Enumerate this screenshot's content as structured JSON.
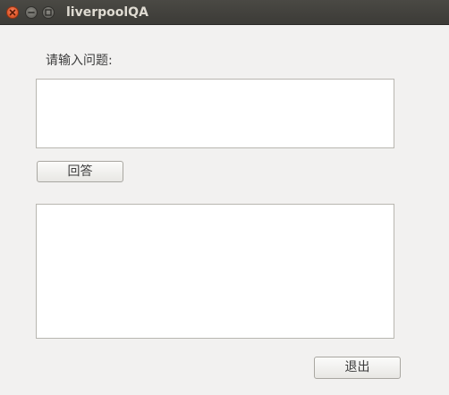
{
  "window": {
    "title": "liverpoolQA",
    "controls": {
      "close_icon": "close-icon",
      "minimize_icon": "minimize-icon",
      "maximize_icon": "maximize-icon"
    }
  },
  "form": {
    "prompt_label": "请输入问题:",
    "question_value": "",
    "answer_button_label": "回答",
    "answer_value": "",
    "exit_button_label": "退出"
  },
  "colors": {
    "close_button": "#e25a2c",
    "titlebar": "#3c3b37",
    "window_background": "#f2f1f0"
  }
}
